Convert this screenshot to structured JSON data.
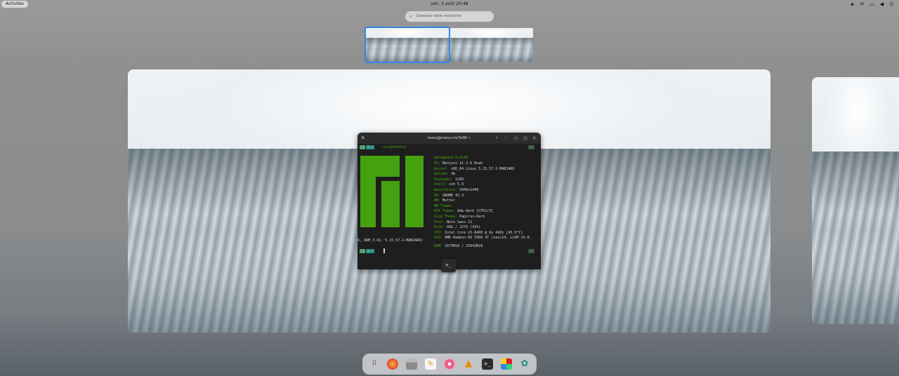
{
  "topbar": {
    "activities": "Activités",
    "clock": "ven. 5 août  20:48",
    "tray_icons": [
      "shield-icon",
      "sync-icon",
      "display-icon",
      "volume-icon",
      "power-icon"
    ]
  },
  "search": {
    "placeholder": "Saisissez votre recherche"
  },
  "workspaces": [
    {
      "active": true
    },
    {
      "active": false
    }
  ],
  "terminal": {
    "title": "manu@manu-ms7b48:~",
    "command": "screenfetch",
    "user_host": "manu@manu-ms7b48",
    "info": [
      {
        "key": "OS:",
        "value": "Manjaro 21.3.6 Ruah"
      },
      {
        "key": "Kernel:",
        "value": "x86_64 Linux 5.15.57-2-MANJARO"
      },
      {
        "key": "Uptime:",
        "value": "3m"
      },
      {
        "key": "Packages:",
        "value": "1289"
      },
      {
        "key": "Shell:",
        "value": "zsh 5.9"
      },
      {
        "key": "Resolution:",
        "value": "3440x1440"
      },
      {
        "key": "DE:",
        "value": "GNOME 42.3"
      },
      {
        "key": "WM:",
        "value": "Mutter"
      },
      {
        "key": "WM Theme:",
        "value": ""
      },
      {
        "key": "GTK Theme:",
        "value": "Adw-dark [GTK2/3]"
      },
      {
        "key": "Icon Theme:",
        "value": "Papirus-Dark"
      },
      {
        "key": "Font:",
        "value": "Noto Sans 11"
      },
      {
        "key": "Disk:",
        "value": "89G / 227G (42%)"
      },
      {
        "key": "CPU:",
        "value": "Intel Core i5-8400 @ 6x 4GHz [45.0°C]"
      },
      {
        "key": "GPU:",
        "value": "AMD Radeon RX 5500 XT (navi14, LLVM 14.0."
      }
    ],
    "wrap_line": "6, DRM 3.42, 5.15.57-2-MANJARO)",
    "ram": {
      "key": "RAM:",
      "value": "1675MiB / 15942MiB"
    },
    "check": "✓",
    "home": "⌂ ~"
  },
  "overlay_app_icon": ">_",
  "dock": [
    "app-grid-icon",
    "firefox-icon",
    "files-icon",
    "text-editor-icon",
    "lollypop-icon",
    "vlc-icon",
    "terminal-icon",
    "software-icon",
    "extension-icon"
  ],
  "colors": {
    "accent": "#3584e4",
    "manjaro_green": "#45a10f",
    "terminal_bg": "#1e1e1e"
  }
}
